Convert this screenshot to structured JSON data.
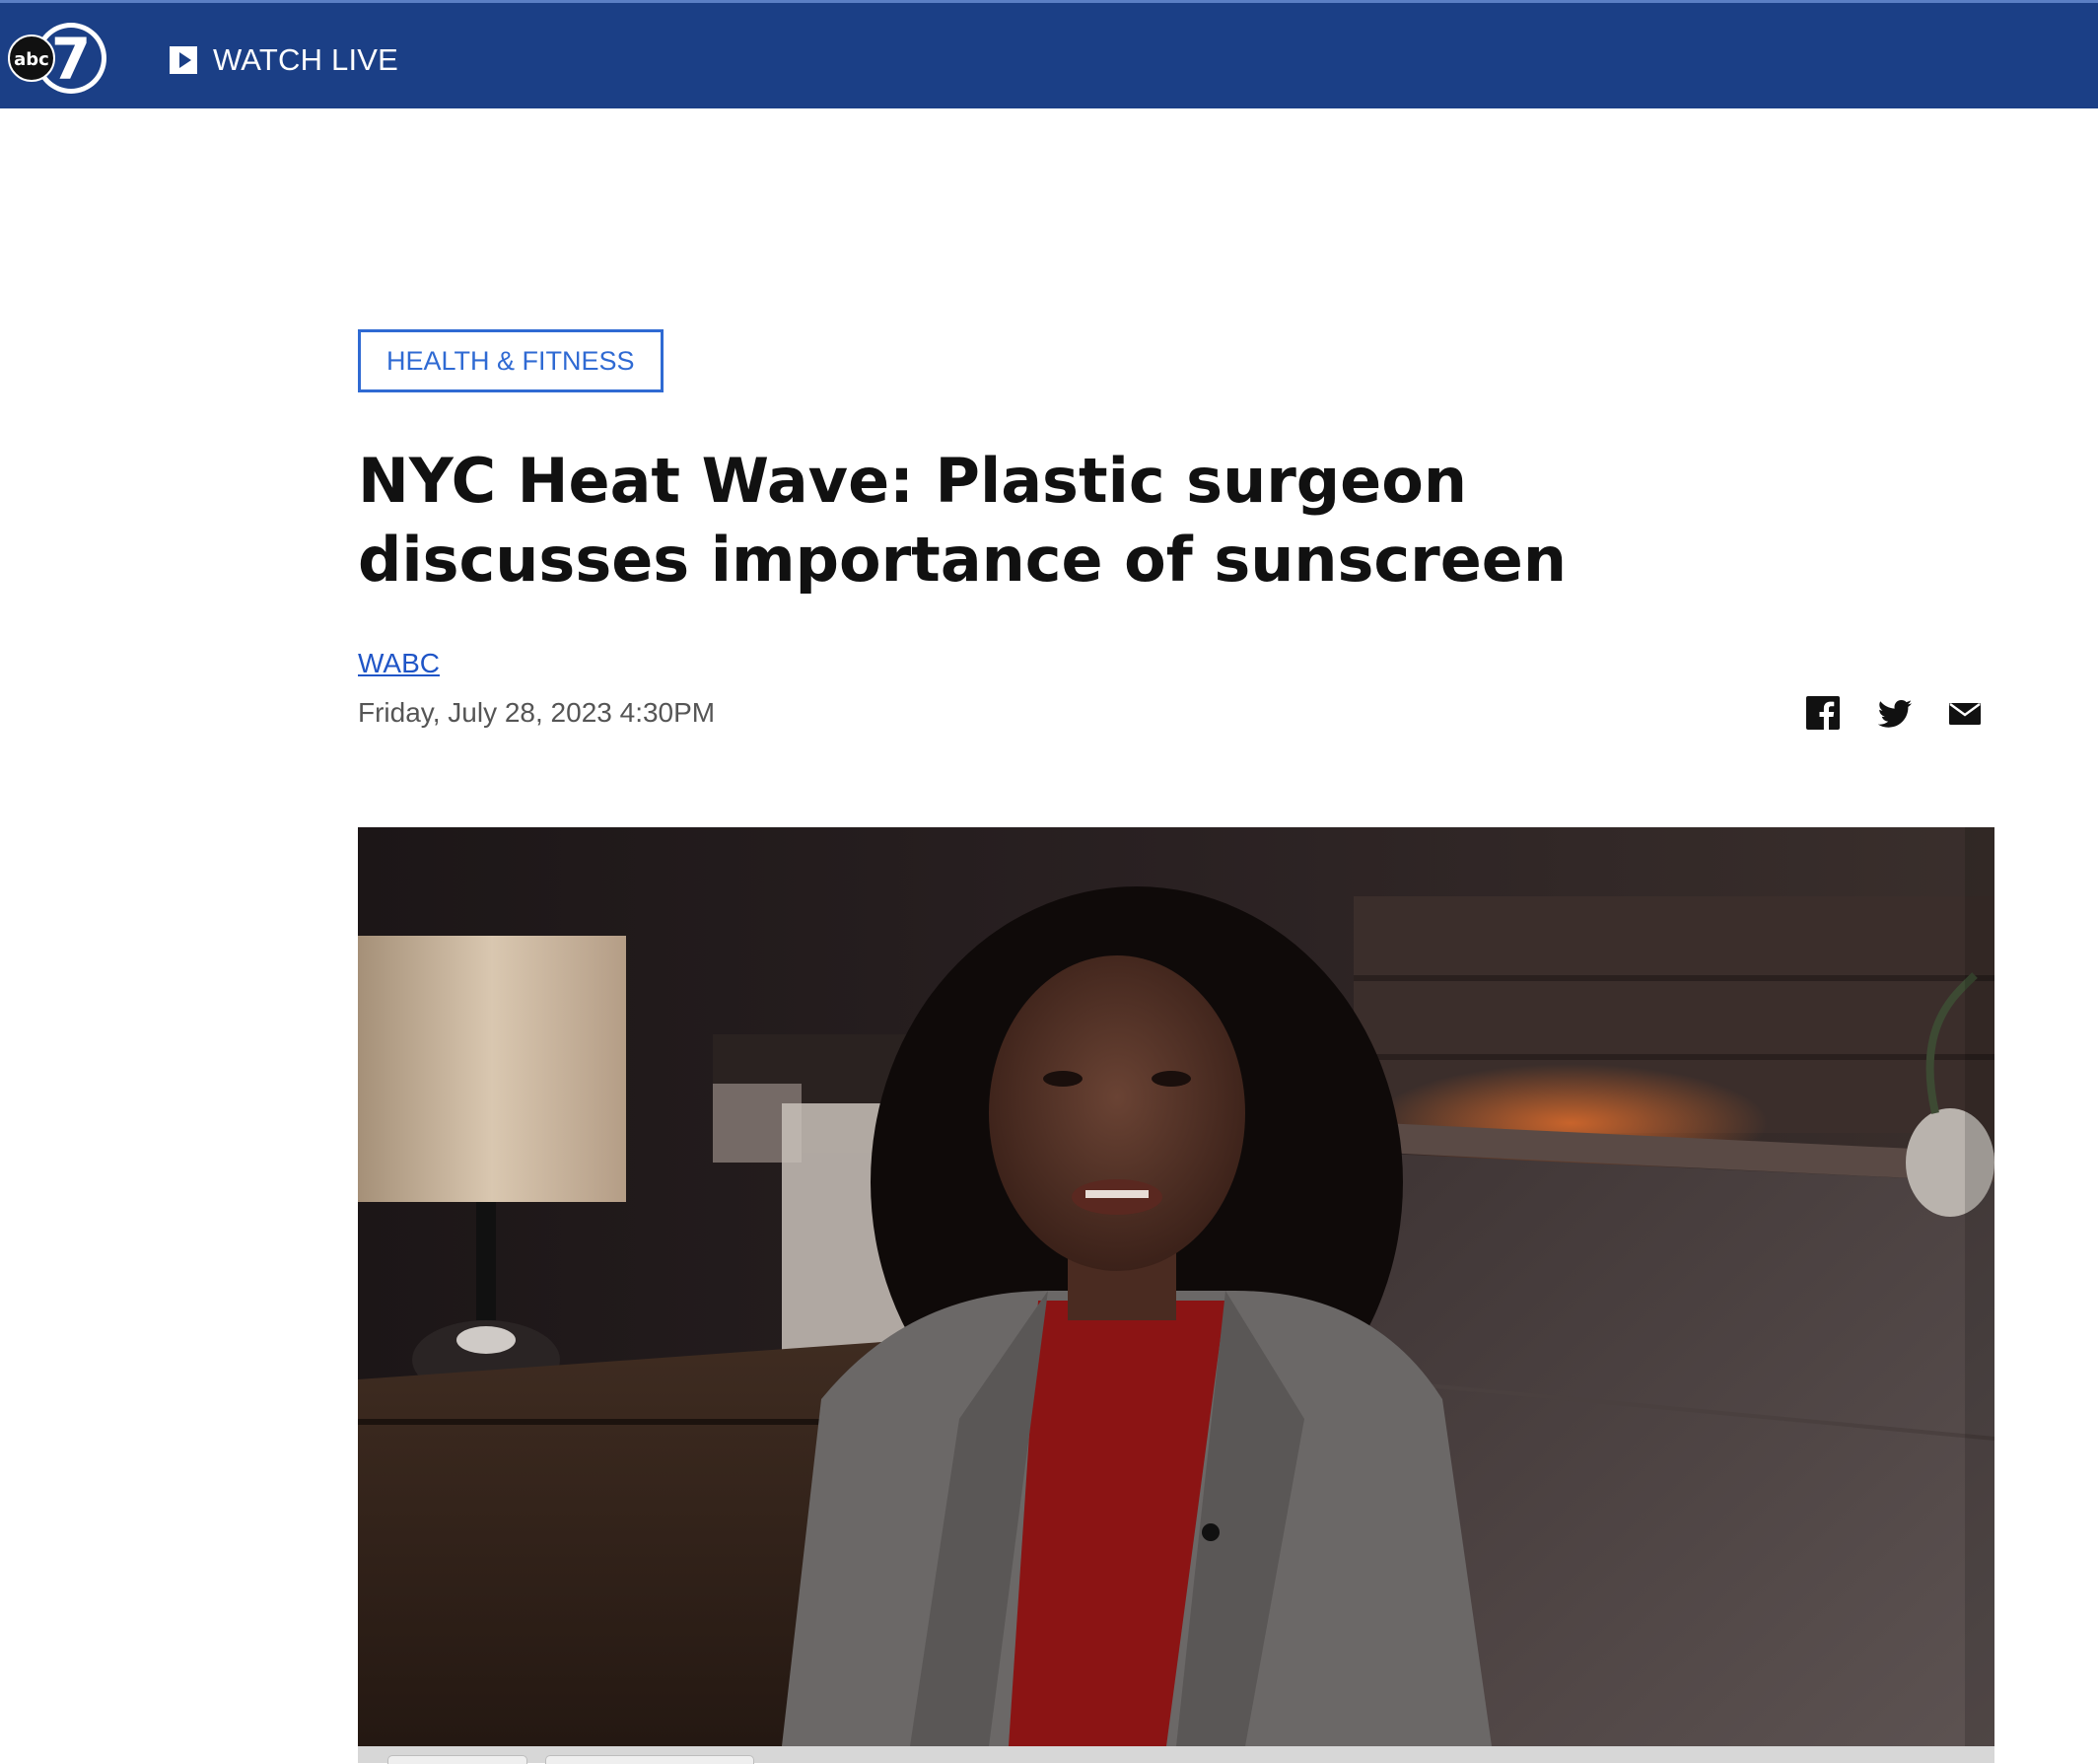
{
  "nav": {
    "logo_alt": "abc7",
    "logo_abc": "abc",
    "logo_number": "7",
    "watch_live_label": "WATCH LIVE",
    "play_icon": "play-icon",
    "background_color": "#1b3f86"
  },
  "article": {
    "category": "HEALTH & FITNESS",
    "headline": "NYC Heat Wave: Plastic surgeon discusses importance of sunscreen",
    "byline": "WABC",
    "date": "Friday, July 28, 2023 4:30PM",
    "accent_color": "#2f6ad3"
  },
  "share": {
    "icons": [
      "facebook-icon",
      "twitter-icon",
      "email-icon"
    ]
  },
  "video": {
    "description_icon": "video-player"
  }
}
